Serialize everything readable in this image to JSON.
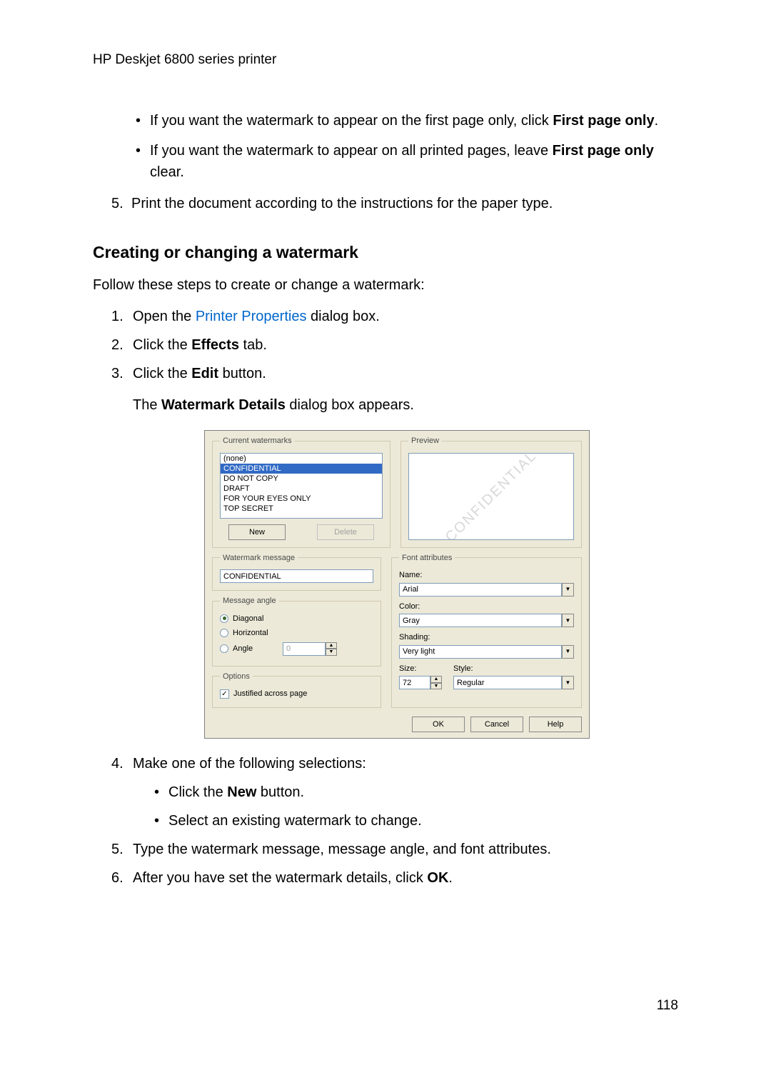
{
  "header": "HP Deskjet 6800 series printer",
  "top_bullets": [
    {
      "pre": "If you want the watermark to appear on the first page only, click ",
      "bold": "First page only",
      "post": "."
    },
    {
      "pre": "If you want the watermark to appear on all printed pages, leave ",
      "bold": "First page only",
      "post": " clear."
    }
  ],
  "top_step5": {
    "num": "5.",
    "text": "Print the document according to the instructions for the paper type."
  },
  "section_heading": "Creating or changing a watermark",
  "intro": "Follow these steps to create or change a watermark:",
  "steps": {
    "s1": {
      "num": "1.",
      "pre": "Open the ",
      "link": "Printer Properties",
      "post": " dialog box."
    },
    "s2": {
      "num": "2.",
      "pre": "Click the ",
      "bold": "Effects",
      "post": " tab."
    },
    "s3": {
      "num": "3.",
      "pre": "Click the ",
      "bold": "Edit",
      "post": " button."
    },
    "s3_note": {
      "pre": "The ",
      "bold": "Watermark Details",
      "post": " dialog box appears."
    },
    "s4": {
      "num": "4.",
      "text": "Make one of the following selections:"
    },
    "s4_sub1": {
      "pre": "Click the ",
      "bold": "New",
      "post": " button."
    },
    "s4_sub2": "Select an existing watermark to change.",
    "s5": {
      "num": "5.",
      "text": "Type the watermark message, message angle, and font attributes."
    },
    "s6": {
      "num": "6.",
      "pre": "After you have set the watermark details, click ",
      "bold": "OK",
      "post": "."
    }
  },
  "dialog": {
    "groups": {
      "current": "Current watermarks",
      "preview": "Preview",
      "message": "Watermark message",
      "angle": "Message angle",
      "options": "Options",
      "font": "Font attributes"
    },
    "watermarks": [
      "(none)",
      "CONFIDENTIAL",
      "DO NOT COPY",
      "DRAFT",
      "FOR YOUR EYES ONLY",
      "TOP SECRET"
    ],
    "selected_watermark": "CONFIDENTIAL",
    "btn_new": "New",
    "btn_delete": "Delete",
    "preview_text": "CONFIDENTIAL",
    "message_value": "CONFIDENTIAL",
    "angle_diagonal": "Diagonal",
    "angle_horizontal": "Horizontal",
    "angle_angle": "Angle",
    "angle_value": "0",
    "justified": "Justified across page",
    "font_name_label": "Name:",
    "font_name": "Arial",
    "font_color_label": "Color:",
    "font_color": "Gray",
    "font_shading_label": "Shading:",
    "font_shading": "Very light",
    "font_size_label": "Size:",
    "font_size": "72",
    "font_style_label": "Style:",
    "font_style": "Regular",
    "btn_ok": "OK",
    "btn_cancel": "Cancel",
    "btn_help": "Help"
  },
  "page_number": "118"
}
